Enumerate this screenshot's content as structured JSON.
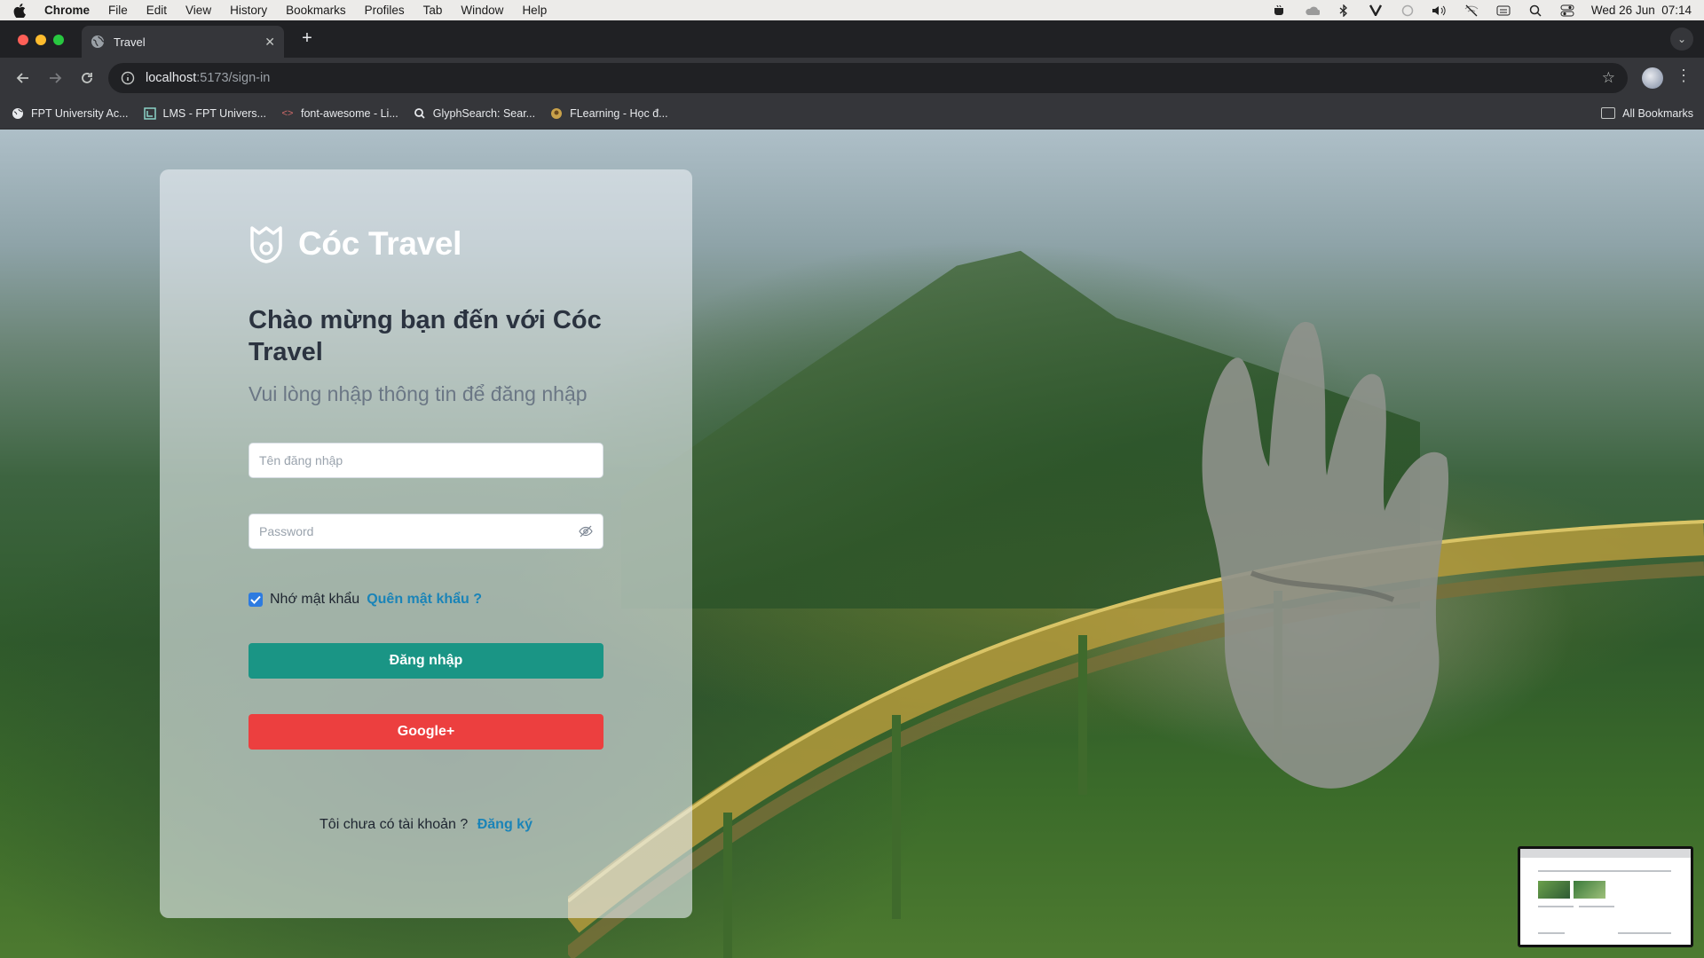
{
  "menubar": {
    "app": "Chrome",
    "items": [
      "File",
      "Edit",
      "View",
      "History",
      "Bookmarks",
      "Profiles",
      "Tab",
      "Window",
      "Help"
    ],
    "clock": "Wed 26 Jun  07:14"
  },
  "browser": {
    "tab_title": "Travel",
    "url_host": "localhost",
    "url_path": ":5173/sign-in",
    "bookmarks": [
      {
        "label": "FPT University Ac...",
        "icon": "globe-icon"
      },
      {
        "label": "LMS - FPT Univers...",
        "icon": "lms-icon"
      },
      {
        "label": "font-awesome - Li...",
        "icon": "code-icon"
      },
      {
        "label": "GlyphSearch: Sear...",
        "icon": "glyph-icon"
      },
      {
        "label": "FLearning - Học đ...",
        "icon": "flearning-icon"
      }
    ],
    "all_bookmarks": "All Bookmarks"
  },
  "login": {
    "brand": "Cóc Travel",
    "welcome": "Chào mừng bạn đến với Cóc Travel",
    "subtitle": "Vui lòng nhập thông tin để đăng nhập",
    "username_placeholder": "Tên đăng nhập",
    "password_placeholder": "Password",
    "remember_label": "Nhớ mật khẩu",
    "remember_checked": true,
    "forgot_label": "Quên mật khẩu ?",
    "login_button": "Đăng nhập",
    "google_button": "Google+",
    "no_account": "Tôi chưa có tài khoản ?",
    "signup_link": "Đăng ký"
  },
  "colors": {
    "primary": "#1a9585",
    "google": "#ec3f3f",
    "link": "#1a84b8",
    "checkbox": "#2d7be0"
  }
}
